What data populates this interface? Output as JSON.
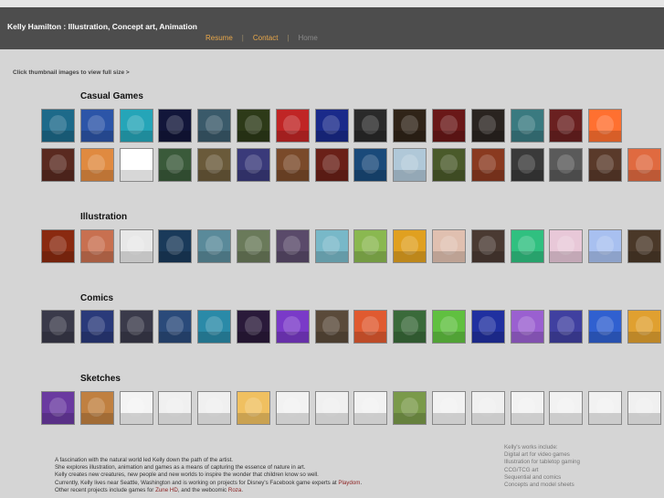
{
  "header": {
    "title": "Kelly Hamilton : Illustration, Concept art, Animation",
    "nav": {
      "resume": "Resume",
      "contact": "Contact",
      "home": "Home",
      "sep": "|"
    }
  },
  "hint": "Click thumbnail images to view full size >",
  "sections": [
    {
      "title": "Casual Games",
      "rows": [
        [
          "#1d6a8a",
          "#2c55a8",
          "#25a5b8",
          "#12163a",
          "#3a5a6a",
          "#2d3a18",
          "#c02525",
          "#1a2a8a",
          "#2a2a2a",
          "#302418",
          "#6a1818",
          "#2a2420",
          "#3a7a80",
          "#6a2020",
          "#ff7030"
        ],
        [
          "#5a2a20",
          "#e08a40",
          "#ffffff",
          "#3a5a3a",
          "#6a5a3a",
          "#3a3a7a",
          "#7a4a2a",
          "#6a2018",
          "#1a4a7a",
          "#b0c8d8",
          "#4a5a2a",
          "#8a3a20",
          "#3a3a3a",
          "#5a5a5a",
          "#5a3a2a",
          "#e06a40"
        ]
      ]
    },
    {
      "title": "Illustration",
      "rows": [
        [
          "#8a2a10",
          "#c87050",
          "#e8e8e8",
          "#1a3a5a",
          "#5a8a9a",
          "#6a7a5a",
          "#5a4a6a",
          "#78b8c8",
          "#8ab850",
          "#e0a020",
          "#e0c0b0",
          "#4a3a32",
          "#30c080",
          "#e8c8d8",
          "#a8c0f0",
          "#4a3828"
        ]
      ]
    },
    {
      "title": "Comics",
      "rows": [
        [
          "#3a3a4a",
          "#2a3a7a",
          "#3a3a4a",
          "#2a4a7a",
          "#2a8aa8",
          "#2a1a3a",
          "#7a3ac8",
          "#5a4a3a",
          "#e05a30",
          "#3a6a3a",
          "#60c040",
          "#2030a0",
          "#9a60d0",
          "#4040a0",
          "#3060d0",
          "#e0a030"
        ]
      ]
    },
    {
      "title": "Sketches",
      "rows": [
        [
          "#6a3aa0",
          "#c08040",
          "#f4f4f4",
          "#f0f0f0",
          "#f0f0f0",
          "#f0c060",
          "#f2f2f2",
          "#f0f0f0",
          "#f2f2f2",
          "#7a9a4a",
          "#f2f2f2",
          "#f0f0f0",
          "#f2f2f2",
          "#f2f2f2",
          "#f2f2f2",
          "#f0f0f0"
        ]
      ]
    }
  ],
  "about": {
    "l1": "A fascination with the natural world led Kelly down the path of the artist.",
    "l2": "She explores illustration, animation and games as a means of capturing the essence of nature in art.",
    "l3": "Kelly creates new creatures, new people and new worlds to inspire the wonder that children know so well.",
    "l4a": "Currently, Kelly lives near Seattle, Washington and is working on projects for Disney's Facebook game experts at ",
    "l4link": "Playdom",
    "l4b": ".",
    "l5a": "Other recent projects include games for ",
    "l5link1": "Zune HD",
    "l5b": ", and the webcomic ",
    "l5link2": "Roza",
    "l5c": "."
  },
  "works": {
    "heading": "Kelly's works include:",
    "items": [
      "Digital art for video games",
      "Illustration for tabletop gaming",
      "CCG/TCG art",
      "Sequential and comics",
      "Concepts and model sheets"
    ]
  }
}
